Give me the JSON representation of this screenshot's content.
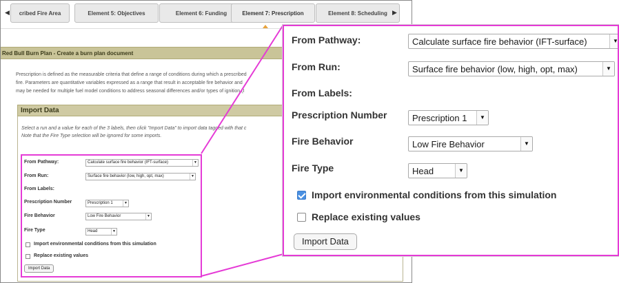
{
  "tabs": {
    "prev_arrow": "◀",
    "next_arrow": "▶",
    "items": [
      {
        "label": "cribed Fire Area"
      },
      {
        "label": "Element 5: Objectives"
      },
      {
        "label": "Element 6: Funding"
      },
      {
        "label": "Element 7: Prescription"
      },
      {
        "label": "Element 8: Scheduling"
      }
    ],
    "active_index": 3
  },
  "page": {
    "title": "Red Bull Burn Plan - Create a burn plan document",
    "description_lines": [
      "Prescription is defined as the measurable criteria that define a range of conditions during which a prescribed",
      "fire. Parameters are quantitative variables expressed as a range that result in acceptable fire behavior and",
      "may be needed for multiple fuel model conditions to address seasonal differences and/or types of ignition (I"
    ]
  },
  "import_section": {
    "header": "Import Data",
    "instructions": [
      "Select a run and a value for each of the 3 labels, then click \"Import Data\" to import data tagged with that c",
      "Note that the Fire Type selection will be ignored for some imports."
    ]
  },
  "form": {
    "from_pathway_label": "From Pathway:",
    "from_pathway_value": "Calculate surface fire behavior (IFT-surface)",
    "from_run_label": "From Run:",
    "from_run_value": "Surface fire behavior (low, high, opt, max)",
    "from_labels_label": "From Labels:",
    "prescription_number_label": "Prescription Number",
    "prescription_number_value": "Prescription 1",
    "fire_behavior_label": "Fire Behavior",
    "fire_behavior_value": "Low Fire Behavior",
    "fire_type_label": "Fire Type",
    "fire_type_value": "Head",
    "import_env_label": "Import environmental conditions from this simulation",
    "import_env_checked_zoom": true,
    "import_env_checked_small": false,
    "replace_label": "Replace existing values",
    "replace_checked": false,
    "import_button": "Import Data",
    "select_caret": "▼"
  },
  "colors": {
    "highlight": "#e53ad6",
    "title_bar": "#c9c498",
    "tab_marker": "#e8a33c",
    "checkbox_checked": "#4a90e2"
  }
}
